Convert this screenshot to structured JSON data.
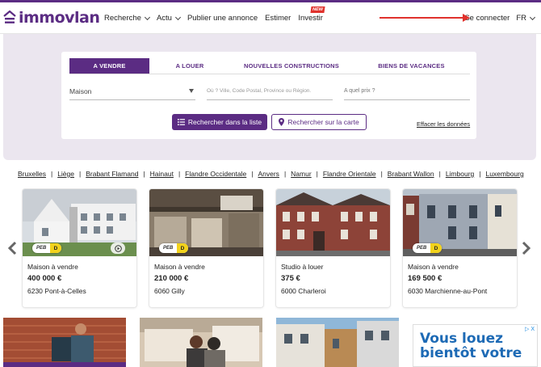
{
  "brand": {
    "name": "immovlan",
    "color": "#5b2c83"
  },
  "nav": {
    "items": [
      {
        "label": "Recherche",
        "has_dropdown": true
      },
      {
        "label": "Actu",
        "has_dropdown": true
      },
      {
        "label": "Publier une annonce",
        "has_dropdown": false
      },
      {
        "label": "Estimer",
        "has_dropdown": false
      },
      {
        "label": "Investir",
        "has_dropdown": false,
        "badge": "NEW"
      }
    ],
    "login": "Se connecter",
    "language": "FR"
  },
  "search": {
    "tabs": [
      "A VENDRE",
      "A LOUER",
      "NOUVELLES CONSTRUCTIONS",
      "BIENS DE VACANCES"
    ],
    "active_tab": "A VENDRE",
    "property_type": "Maison",
    "location_placeholder": "Où ? Ville, Code Postal, Province ou Région.",
    "price_placeholder": "A quel prix ?",
    "list_button": "Rechercher dans la liste",
    "map_button": "Rechercher sur la carte",
    "clear_link": "Effacer les données"
  },
  "regions": [
    "Bruxelles",
    "Liège",
    "Brabant Flamand",
    "Hainaut",
    "Flandre Occidentale",
    "Anvers",
    "Namur",
    "Flandre Orientale",
    "Brabant Wallon",
    "Limbourg",
    "Luxembourg"
  ],
  "listings": [
    {
      "type": "Maison à vendre",
      "price": "400 000 €",
      "location": "6230 Pont-à-Celles",
      "peb": "PEB",
      "peb_grade": "D",
      "peb_color": "#f2d21b",
      "has_video": true
    },
    {
      "type": "Maison à vendre",
      "price": "210 000 €",
      "location": "6060 Gilly",
      "peb": "PEB",
      "peb_grade": "D",
      "peb_color": "#f2d21b",
      "has_video": false
    },
    {
      "type": "Studio à louer",
      "price": "375 €",
      "location": "6000 Charleroi",
      "has_video": false
    },
    {
      "type": "Maison à vendre",
      "price": "169 500 €",
      "location": "6030 Marchienne-au-Pont",
      "peb": "PEB",
      "peb_grade": "D",
      "peb_color": "#f2d21b",
      "has_video": false
    }
  ],
  "ad": {
    "text_line1": "Vous louez",
    "text_line2": "bientôt votre",
    "close": "▷ X"
  }
}
